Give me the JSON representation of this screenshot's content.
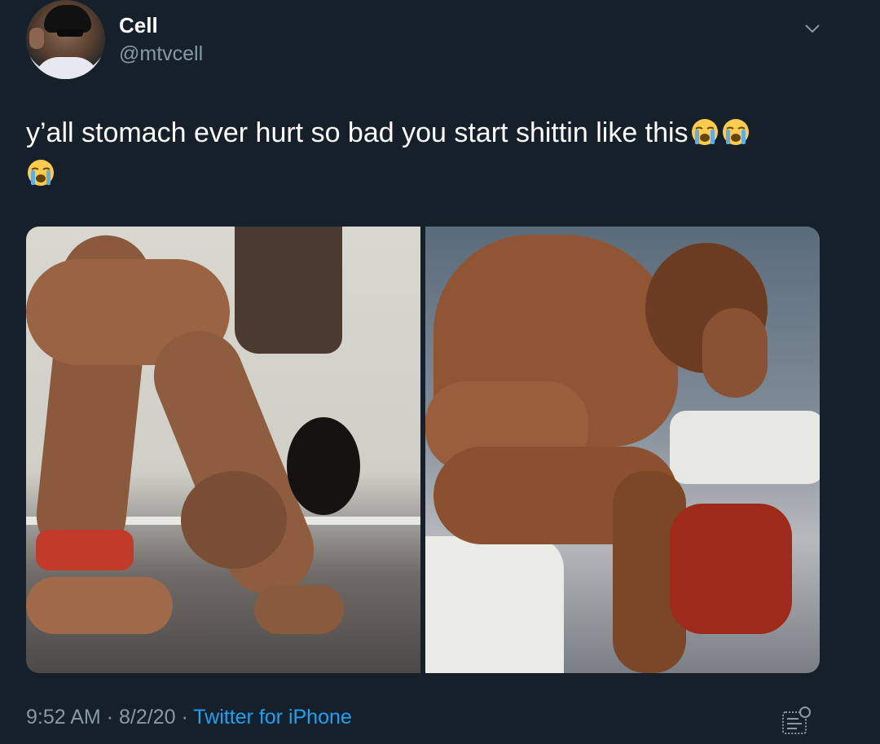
{
  "author": {
    "display_name": "Cell",
    "handle": "@mtvcell",
    "avatar_icon": "profile-photo"
  },
  "menu_icon": "chevron-down-icon",
  "tweet": {
    "text": "y’all stomach ever hurt so bad you start shittin like this",
    "emojis": [
      "loudly-crying-face",
      "loudly-crying-face",
      "loudly-crying-face"
    ]
  },
  "media": {
    "photos": [
      {
        "name": "photo-person-bent-over-floor"
      },
      {
        "name": "photo-person-hunched-on-toilet"
      }
    ]
  },
  "meta": {
    "time": "9:52 AM",
    "separator": "·",
    "date": "8/2/20",
    "source": "Twitter for iPhone",
    "analytics_icon": "analytics-icon"
  },
  "colors": {
    "background": "#15202b",
    "secondary_text": "#8899a6",
    "link": "#1da1f2"
  }
}
